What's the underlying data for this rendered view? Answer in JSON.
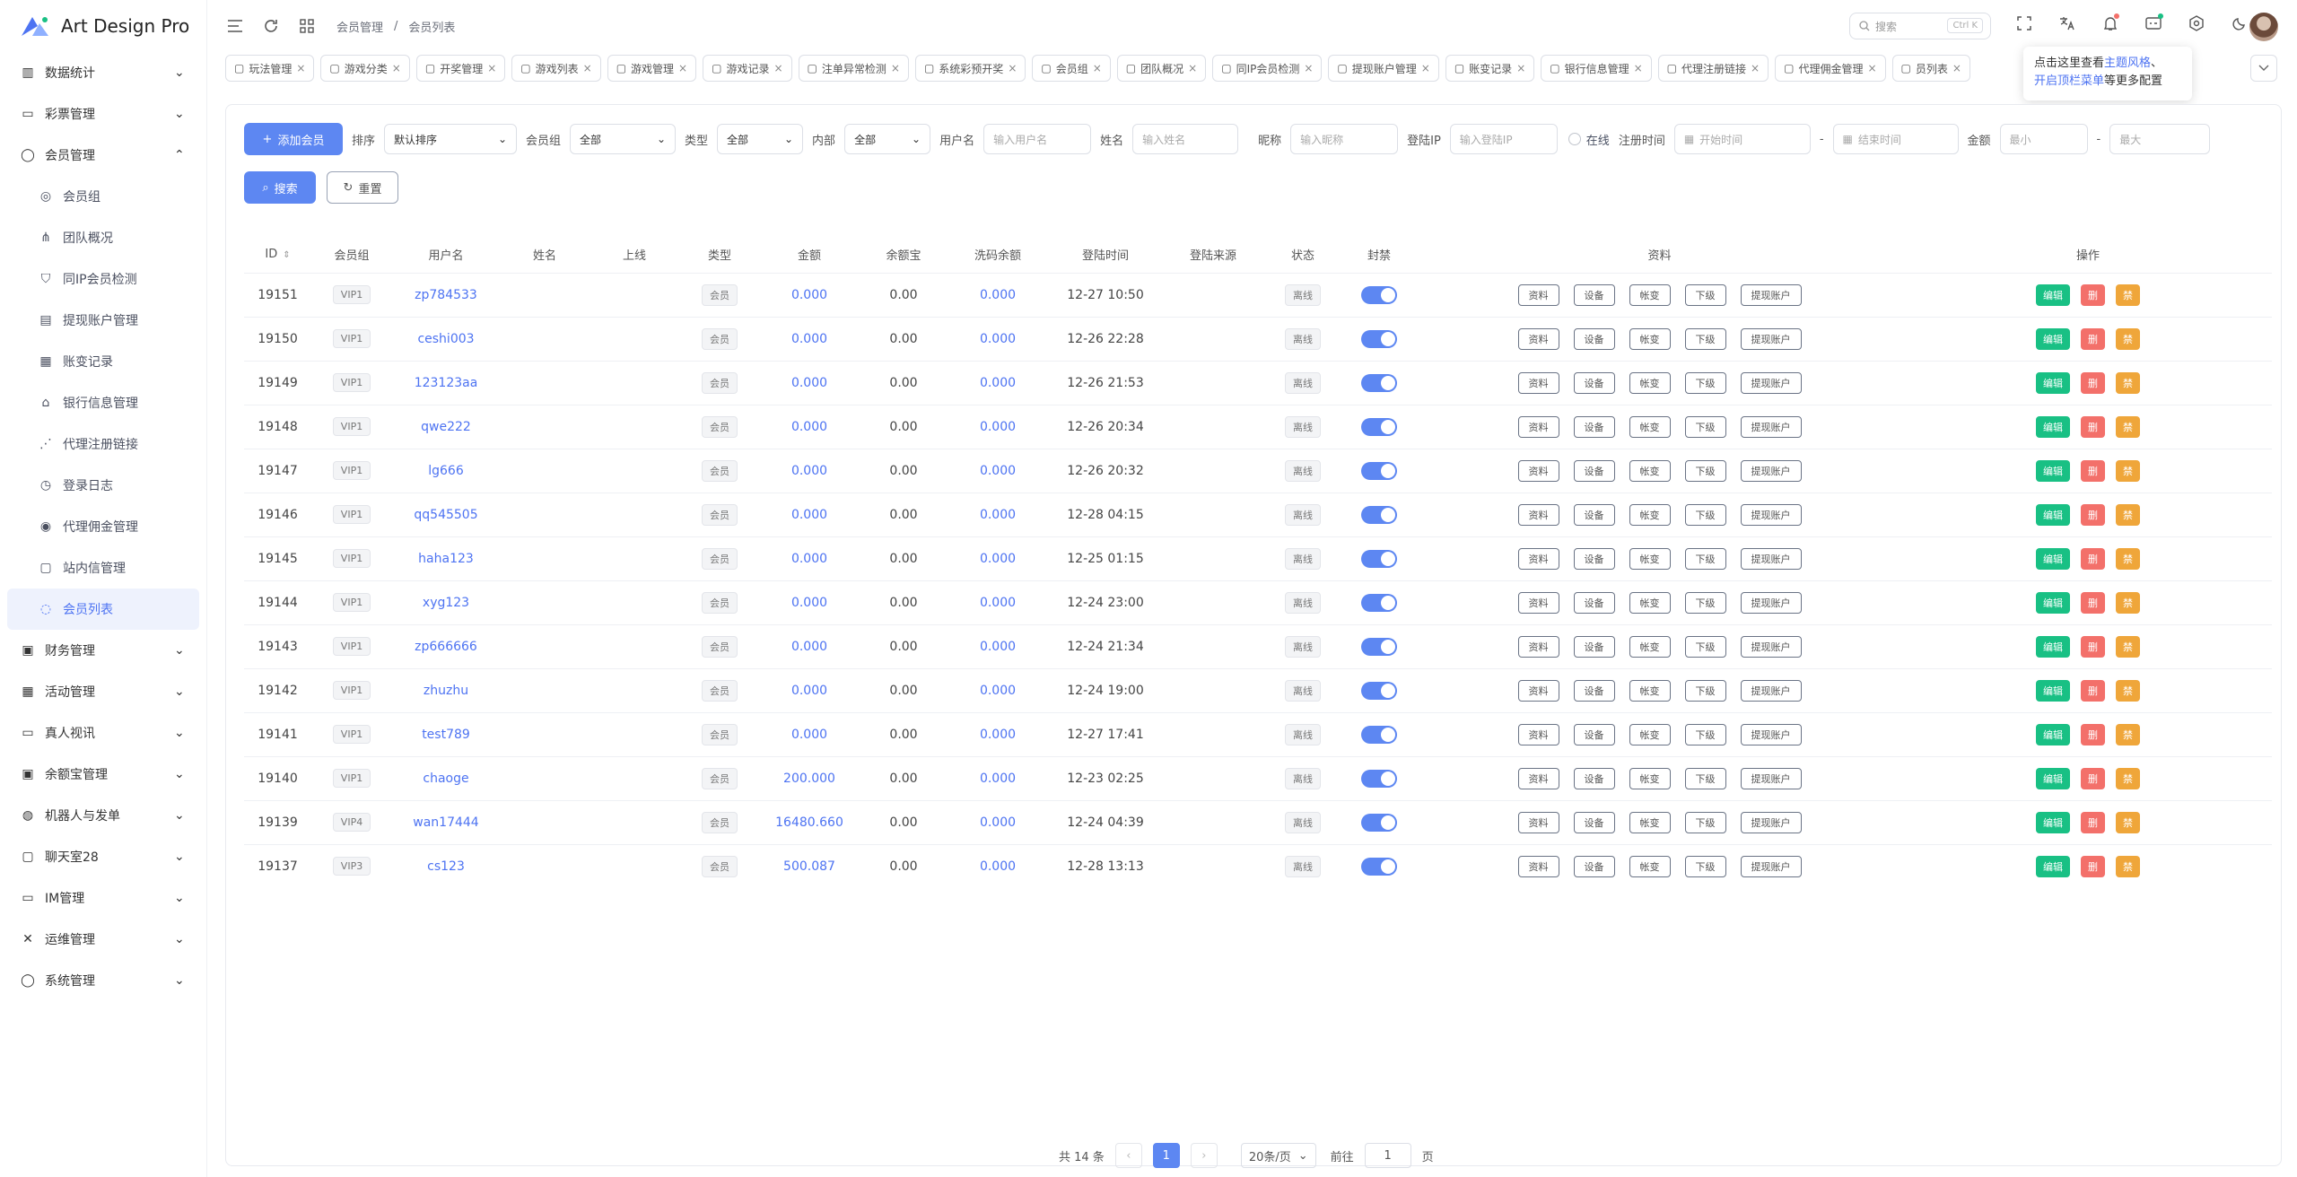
{
  "app": {
    "title": "Art Design Pro"
  },
  "breadcrumb": {
    "parent": "会员管理",
    "sep": "/",
    "current": "会员列表"
  },
  "search": {
    "placeholder": "搜索",
    "shortcut": "Ctrl K"
  },
  "tip": {
    "line1_a": "点击这里查看",
    "line1_b": "主题风格",
    "line1_c": "、",
    "line2_a": "开启顶栏菜单",
    "line2_b": "等更多配置"
  },
  "sidebar": {
    "items": [
      {
        "label": "数据统计",
        "icon": "chart-icon",
        "expandable": true
      },
      {
        "label": "彩票管理",
        "icon": "ticket-icon",
        "expandable": true
      },
      {
        "label": "会员管理",
        "icon": "user-icon",
        "expandable": true,
        "open": true
      },
      {
        "label": "会员组",
        "icon": "users-icon",
        "sub": true
      },
      {
        "label": "团队概况",
        "icon": "team-icon",
        "sub": true
      },
      {
        "label": "同IP会员检测",
        "icon": "shield-icon",
        "sub": true
      },
      {
        "label": "提现账户管理",
        "icon": "card-icon",
        "sub": true
      },
      {
        "label": "账变记录",
        "icon": "doc-icon",
        "sub": true
      },
      {
        "label": "银行信息管理",
        "icon": "bank-icon",
        "sub": true
      },
      {
        "label": "代理注册链接",
        "icon": "share-icon",
        "sub": true
      },
      {
        "label": "登录日志",
        "icon": "clock-icon",
        "sub": true
      },
      {
        "label": "代理佣金管理",
        "icon": "coin-icon",
        "sub": true
      },
      {
        "label": "站内信管理",
        "icon": "message-icon",
        "sub": true
      },
      {
        "label": "会员列表",
        "icon": "user-list-icon",
        "sub": true,
        "active": true
      },
      {
        "label": "财务管理",
        "icon": "wallet-icon",
        "expandable": true
      },
      {
        "label": "活动管理",
        "icon": "gift-icon",
        "expandable": true
      },
      {
        "label": "真人视讯",
        "icon": "video-icon",
        "expandable": true
      },
      {
        "label": "余额宝管理",
        "icon": "safe-icon",
        "expandable": true
      },
      {
        "label": "机器人与发单",
        "icon": "robot-icon",
        "expandable": true
      },
      {
        "label": "聊天室28",
        "icon": "chat-icon",
        "expandable": true
      },
      {
        "label": "IM管理",
        "icon": "im-icon",
        "expandable": true
      },
      {
        "label": "运维管理",
        "icon": "tools-icon",
        "expandable": true
      },
      {
        "label": "系统管理",
        "icon": "settings-icon",
        "expandable": true
      }
    ]
  },
  "tabs": [
    "玩法管理",
    "游戏分类",
    "开奖管理",
    "游戏列表",
    "游戏管理",
    "游戏记录",
    "注单异常检测",
    "系统彩预开奖",
    "会员组",
    "团队概况",
    "同IP会员检测",
    "提现账户管理",
    "账变记录",
    "银行信息管理",
    "代理注册链接",
    "代理佣金管理",
    "员列表"
  ],
  "filters": {
    "add_label": "添加会员",
    "sort_label": "排序",
    "sort_value": "默认排序",
    "group_label": "会员组",
    "group_value": "全部",
    "type_label": "类型",
    "type_value": "全部",
    "inner_label": "内部",
    "inner_value": "全部",
    "username_label": "用户名",
    "username_ph": "输入用户名",
    "name_label": "姓名",
    "name_ph": "输入姓名",
    "nick_label": "昵称",
    "nick_ph": "输入昵称",
    "ip_label": "登陆IP",
    "ip_ph": "输入登陆IP",
    "online_label": "在线",
    "regtime_label": "注册时间",
    "start_ph": "开始时间",
    "dash": "-",
    "end_ph": "结束时间",
    "amount_label": "金额",
    "min_ph": "最小",
    "max_ph": "最大",
    "search_label": "搜索",
    "reset_label": "重置"
  },
  "table": {
    "headers": [
      "ID",
      "会员组",
      "用户名",
      "姓名",
      "上线",
      "类型",
      "金额",
      "余额宝",
      "洗码余额",
      "登陆时间",
      "登陆来源",
      "状态",
      "封禁",
      "资料",
      "操作"
    ],
    "detail_buttons": [
      "资料",
      "设备",
      "帐变",
      "下级",
      "提现账户"
    ],
    "action_buttons": [
      "编辑",
      "删",
      "禁"
    ],
    "rows": [
      {
        "id": "19151",
        "group": "VIP1",
        "user": "zp784533",
        "type": "会员",
        "amount": "0.000",
        "yeb": "0.00",
        "wash": "0.000",
        "time": "12-27 10:50",
        "status": "离线"
      },
      {
        "id": "19150",
        "group": "VIP1",
        "user": "ceshi003",
        "type": "会员",
        "amount": "0.000",
        "yeb": "0.00",
        "wash": "0.000",
        "time": "12-26 22:28",
        "status": "离线"
      },
      {
        "id": "19149",
        "group": "VIP1",
        "user": "123123aa",
        "type": "会员",
        "amount": "0.000",
        "yeb": "0.00",
        "wash": "0.000",
        "time": "12-26 21:53",
        "status": "离线"
      },
      {
        "id": "19148",
        "group": "VIP1",
        "user": "qwe222",
        "type": "会员",
        "amount": "0.000",
        "yeb": "0.00",
        "wash": "0.000",
        "time": "12-26 20:34",
        "status": "离线"
      },
      {
        "id": "19147",
        "group": "VIP1",
        "user": "lg666",
        "type": "会员",
        "amount": "0.000",
        "yeb": "0.00",
        "wash": "0.000",
        "time": "12-26 20:32",
        "status": "离线"
      },
      {
        "id": "19146",
        "group": "VIP1",
        "user": "qq545505",
        "type": "会员",
        "amount": "0.000",
        "yeb": "0.00",
        "wash": "0.000",
        "time": "12-28 04:15",
        "status": "离线"
      },
      {
        "id": "19145",
        "group": "VIP1",
        "user": "haha123",
        "type": "会员",
        "amount": "0.000",
        "yeb": "0.00",
        "wash": "0.000",
        "time": "12-25 01:15",
        "status": "离线"
      },
      {
        "id": "19144",
        "group": "VIP1",
        "user": "xyg123",
        "type": "会员",
        "amount": "0.000",
        "yeb": "0.00",
        "wash": "0.000",
        "time": "12-24 23:00",
        "status": "离线"
      },
      {
        "id": "19143",
        "group": "VIP1",
        "user": "zp666666",
        "type": "会员",
        "amount": "0.000",
        "yeb": "0.00",
        "wash": "0.000",
        "time": "12-24 21:34",
        "status": "离线"
      },
      {
        "id": "19142",
        "group": "VIP1",
        "user": "zhuzhu",
        "type": "会员",
        "amount": "0.000",
        "yeb": "0.00",
        "wash": "0.000",
        "time": "12-24 19:00",
        "status": "离线"
      },
      {
        "id": "19141",
        "group": "VIP1",
        "user": "test789",
        "type": "会员",
        "amount": "0.000",
        "yeb": "0.00",
        "wash": "0.000",
        "time": "12-27 17:41",
        "status": "离线"
      },
      {
        "id": "19140",
        "group": "VIP1",
        "user": "chaoge",
        "type": "会员",
        "amount": "200.000",
        "yeb": "0.00",
        "wash": "0.000",
        "time": "12-23 02:25",
        "status": "离线"
      },
      {
        "id": "19139",
        "group": "VIP4",
        "user": "wan17444",
        "type": "会员",
        "amount": "16480.660",
        "yeb": "0.00",
        "wash": "0.000",
        "time": "12-24 04:39",
        "status": "离线"
      },
      {
        "id": "19137",
        "group": "VIP3",
        "user": "cs123",
        "type": "会员",
        "amount": "500.087",
        "yeb": "0.00",
        "wash": "0.000",
        "time": "12-28 13:13",
        "status": "离线"
      }
    ]
  },
  "pagination": {
    "total": "共 14 条",
    "current": "1",
    "size": "20条/页",
    "goto": "前往",
    "page_value": "1",
    "page_unit": "页"
  },
  "colors": {
    "accent": "#5d87f2",
    "green": "#19c084",
    "red": "#f3706a",
    "orange": "#efa63a"
  }
}
